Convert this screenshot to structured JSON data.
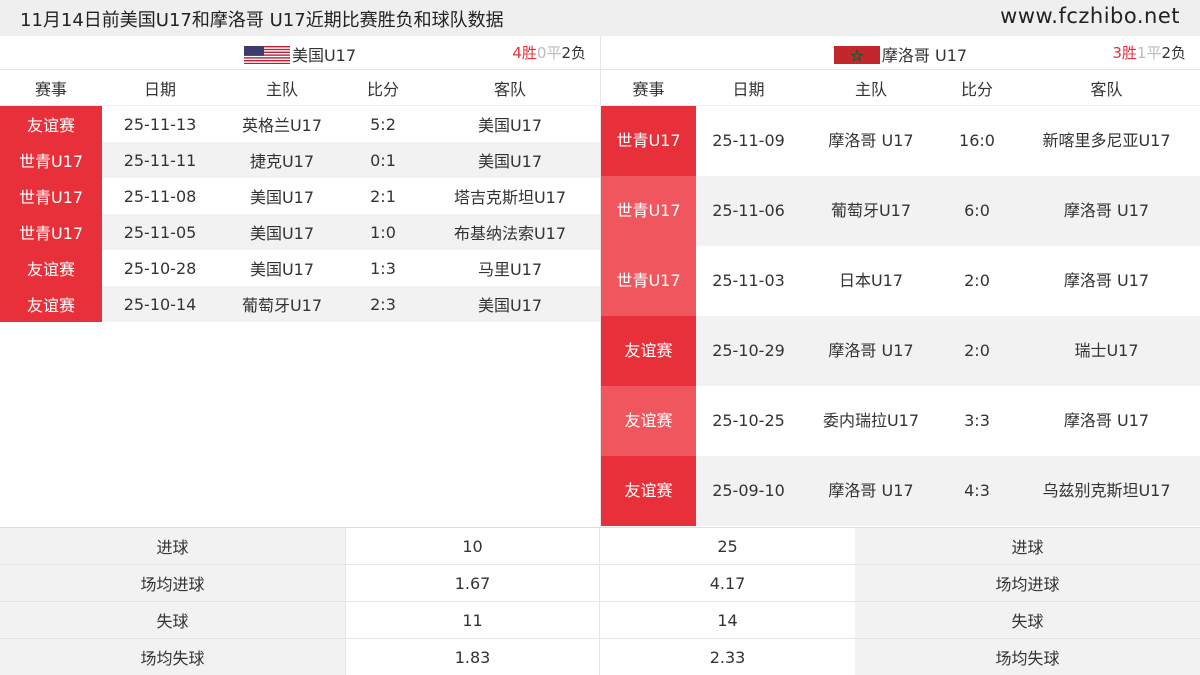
{
  "header": {
    "title": "11月14日前美国U17和摩洛哥 U17近期比赛胜负和球队数据",
    "site": "www.fczhibo.net"
  },
  "columns": {
    "event": "赛事",
    "date": "日期",
    "home": "主队",
    "score": "比分",
    "away": "客队"
  },
  "left": {
    "team": "美国U17",
    "record": {
      "w": "4胜",
      "d": "0平",
      "l": "2负"
    },
    "matches": [
      {
        "event": "友谊赛",
        "date": "25-11-13",
        "home": "英格兰U17",
        "score": "5:2",
        "away": "美国U17"
      },
      {
        "event": "世青U17",
        "date": "25-11-11",
        "home": "捷克U17",
        "score": "0:1",
        "away": "美国U17"
      },
      {
        "event": "世青U17",
        "date": "25-11-08",
        "home": "美国U17",
        "score": "2:1",
        "away": "塔吉克斯坦U17"
      },
      {
        "event": "世青U17",
        "date": "25-11-05",
        "home": "美国U17",
        "score": "1:0",
        "away": "布基纳法索U17"
      },
      {
        "event": "友谊赛",
        "date": "25-10-28",
        "home": "美国U17",
        "score": "1:3",
        "away": "马里U17"
      },
      {
        "event": "友谊赛",
        "date": "25-10-14",
        "home": "葡萄牙U17",
        "score": "2:3",
        "away": "美国U17"
      }
    ]
  },
  "right": {
    "team": "摩洛哥 U17",
    "record": {
      "w": "3胜",
      "d": "1平",
      "l": "2负"
    },
    "matches": [
      {
        "event": "世青U17",
        "date": "25-11-09",
        "home": "摩洛哥 U17",
        "score": "16:0",
        "away": "新喀里多尼亚U17"
      },
      {
        "event": "世青U17",
        "date": "25-11-06",
        "home": "葡萄牙U17",
        "score": "6:0",
        "away": "摩洛哥 U17"
      },
      {
        "event": "世青U17",
        "date": "25-11-03",
        "home": "日本U17",
        "score": "2:0",
        "away": "摩洛哥 U17"
      },
      {
        "event": "友谊赛",
        "date": "25-10-29",
        "home": "摩洛哥 U17",
        "score": "2:0",
        "away": "瑞士U17"
      },
      {
        "event": "友谊赛",
        "date": "25-10-25",
        "home": "委内瑞拉U17",
        "score": "3:3",
        "away": "摩洛哥 U17"
      },
      {
        "event": "友谊赛",
        "date": "25-09-10",
        "home": "摩洛哥 U17",
        "score": "4:3",
        "away": "乌兹别克斯坦U17"
      }
    ]
  },
  "stats": [
    {
      "label": "进球",
      "left": "10",
      "right": "25"
    },
    {
      "label": "场均进球",
      "left": "1.67",
      "right": "4.17"
    },
    {
      "label": "失球",
      "left": "11",
      "right": "14"
    },
    {
      "label": "场均失球",
      "left": "1.83",
      "right": "2.33"
    }
  ],
  "colors": {
    "event_red": "#e8303a",
    "event_red_light": "#f0565d",
    "win": "#e8303a",
    "draw": "#bbbbbb"
  },
  "icons": {
    "left_flag": "usa-flag-icon",
    "right_flag": "morocco-flag-icon"
  }
}
